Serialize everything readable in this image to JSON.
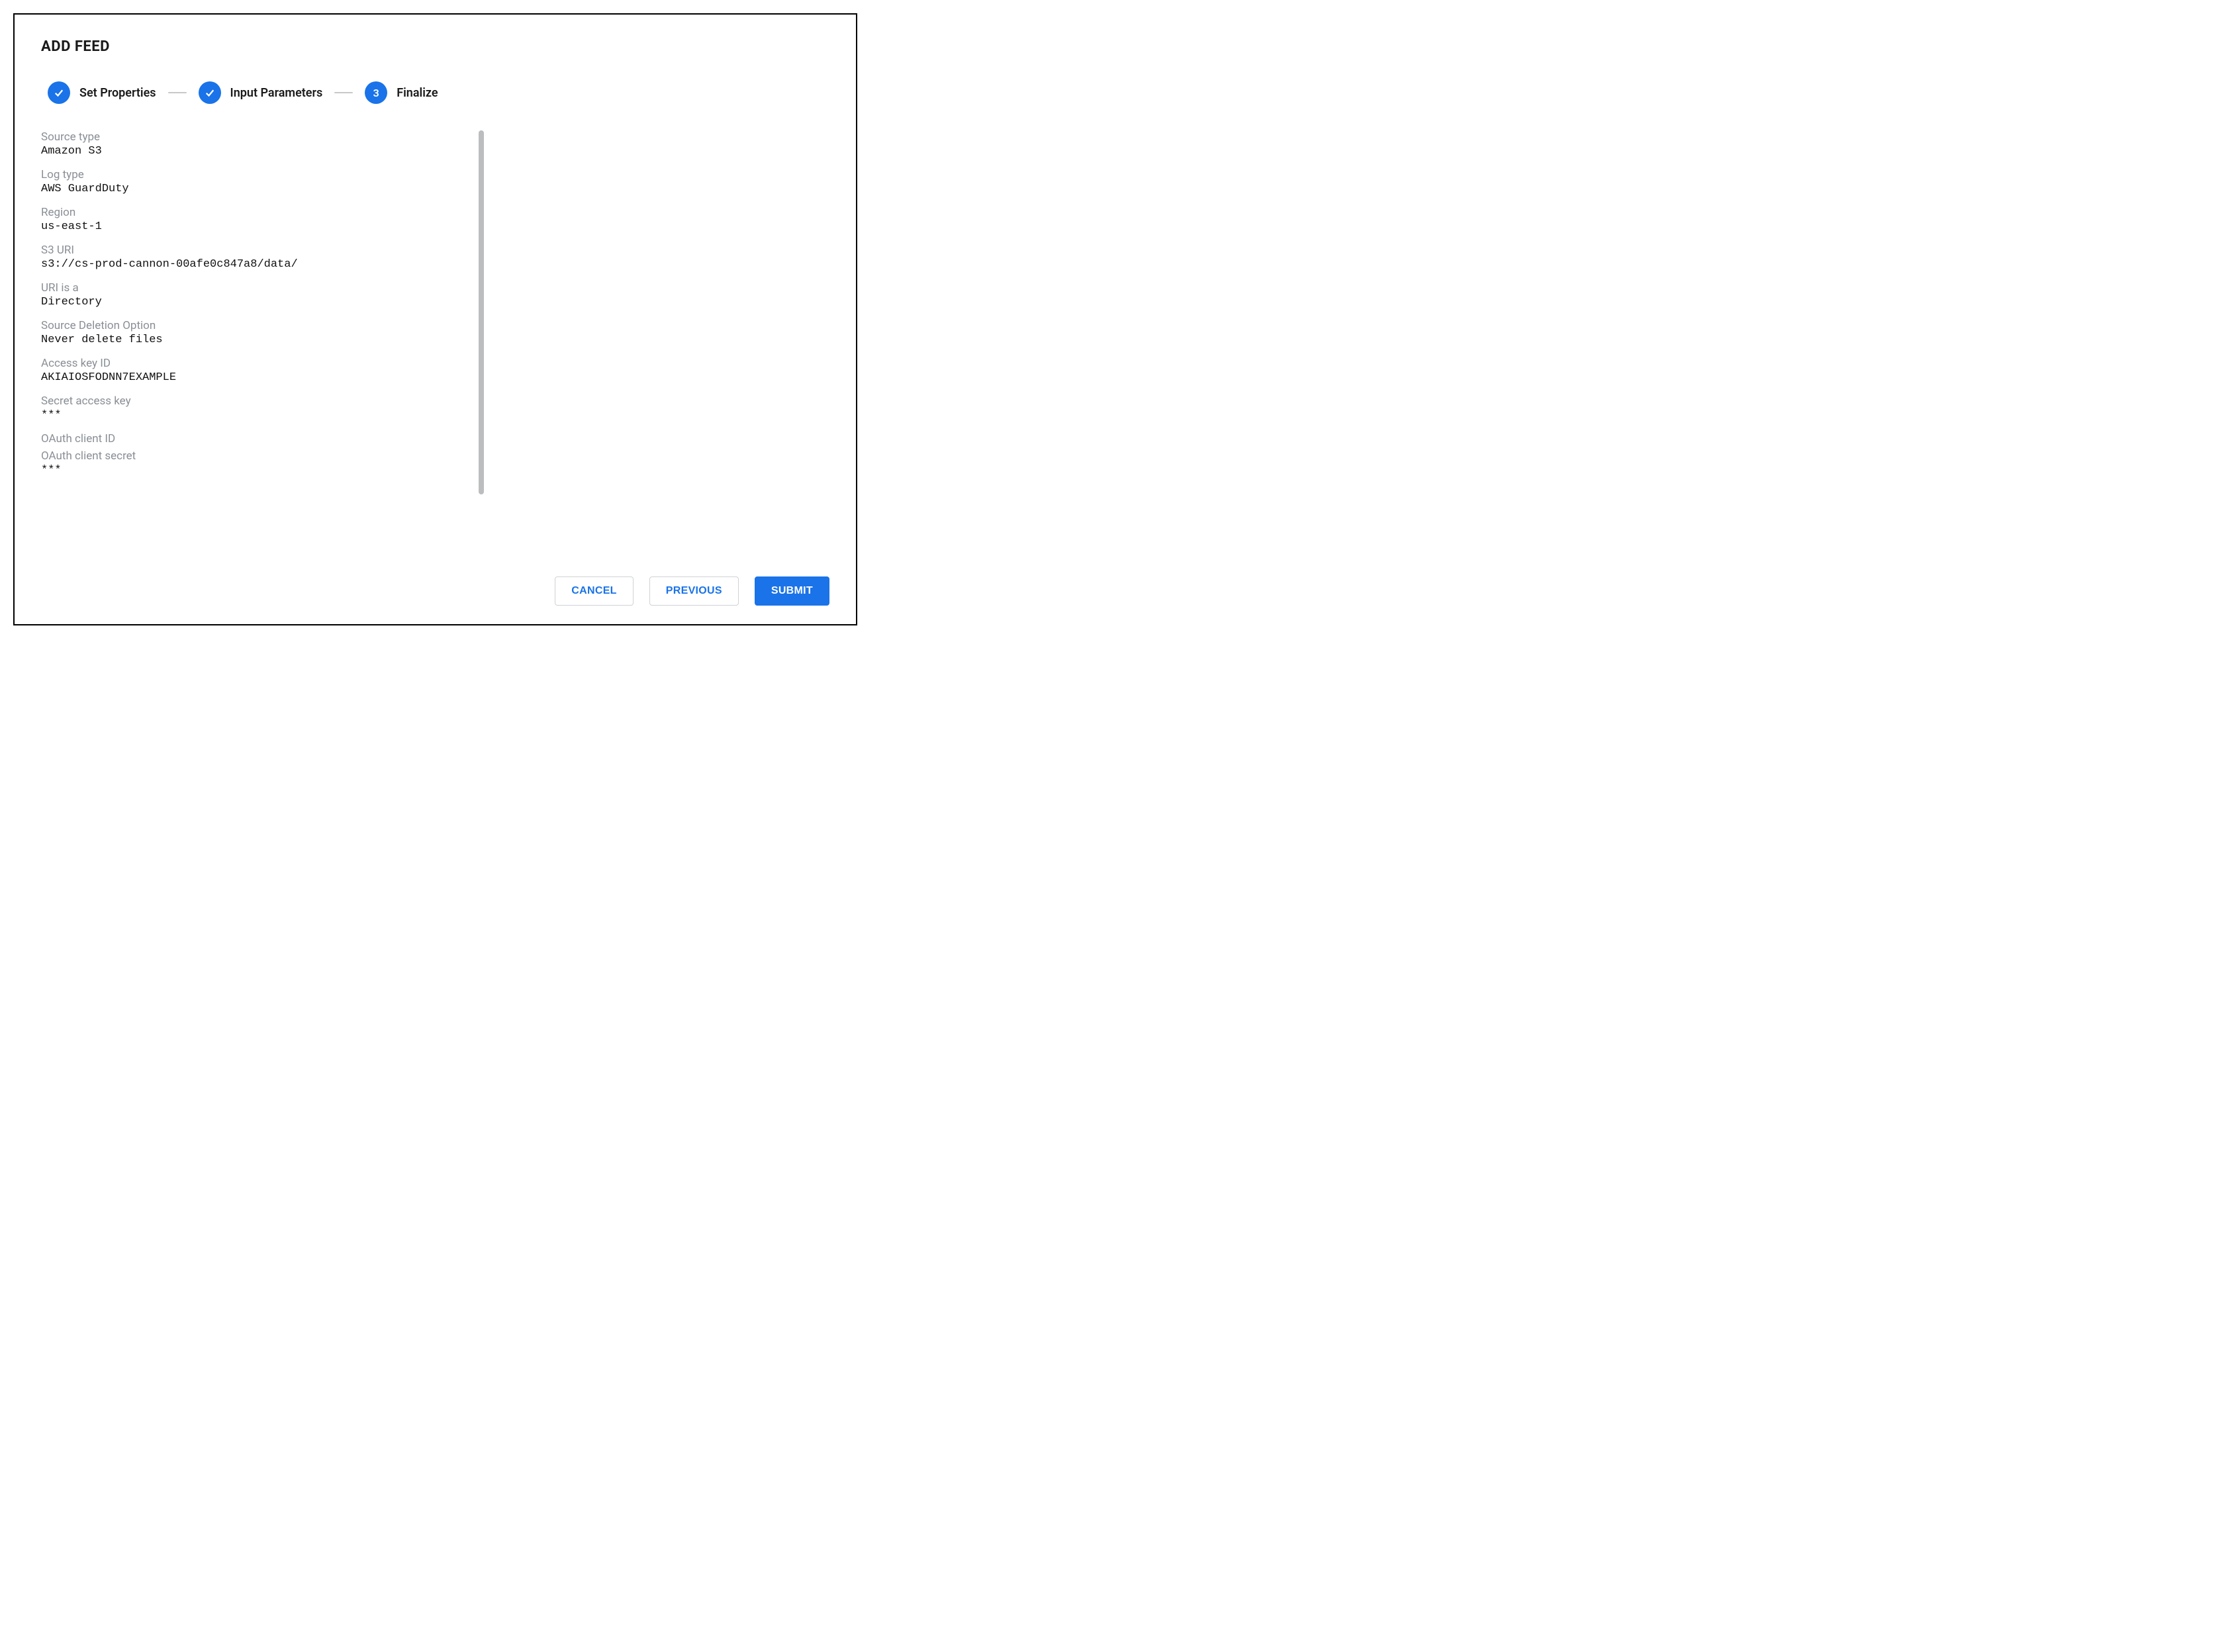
{
  "title": "ADD FEED",
  "stepper": {
    "steps": [
      {
        "label": "Set Properties",
        "status": "done"
      },
      {
        "label": "Input Parameters",
        "status": "done"
      },
      {
        "label": "Finalize",
        "status": "current",
        "number": "3"
      }
    ]
  },
  "fields": [
    {
      "label": "Source type",
      "value": "Amazon S3"
    },
    {
      "label": "Log type",
      "value": "AWS GuardDuty"
    },
    {
      "label": "Region",
      "value": "us-east-1"
    },
    {
      "label": "S3 URI",
      "value": "s3://cs-prod-cannon-00afe0c847a8/data/"
    },
    {
      "label": "URI is a",
      "value": "Directory"
    },
    {
      "label": "Source Deletion Option",
      "value": "Never delete files"
    },
    {
      "label": "Access key ID",
      "value": "AKIAIOSFODNN7EXAMPLE"
    },
    {
      "label": "Secret access key",
      "value": "***"
    },
    {
      "label": "OAuth client ID",
      "value": ""
    },
    {
      "label": "OAuth client secret",
      "value": "***"
    }
  ],
  "buttons": {
    "cancel": "CANCEL",
    "previous": "PREVIOUS",
    "submit": "SUBMIT"
  }
}
